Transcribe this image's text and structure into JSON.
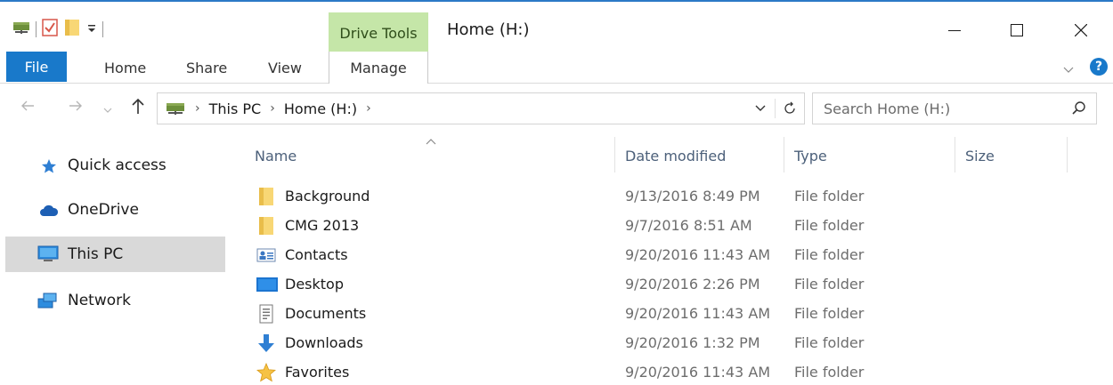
{
  "window": {
    "title": "Home (H:)",
    "context_tab": "Drive Tools"
  },
  "ribbon": {
    "tabs": [
      "File",
      "Home",
      "Share",
      "View",
      "Manage"
    ]
  },
  "address": {
    "crumbs": [
      "This PC",
      "Home (H:)"
    ]
  },
  "search": {
    "placeholder": "Search Home (H:)"
  },
  "sidebar": {
    "items": [
      {
        "label": "Quick access",
        "icon": "star-icon"
      },
      {
        "label": "OneDrive",
        "icon": "cloud-icon"
      },
      {
        "label": "This PC",
        "icon": "computer-icon",
        "selected": true
      },
      {
        "label": "Network",
        "icon": "network-icon"
      }
    ]
  },
  "columns": [
    "Name",
    "Date modified",
    "Type",
    "Size"
  ],
  "files": [
    {
      "name": "Background",
      "date": "9/13/2016 8:49 PM",
      "type": "File folder",
      "icon": "folder-icon"
    },
    {
      "name": "CMG 2013",
      "date": "9/7/2016 8:51 AM",
      "type": "File folder",
      "icon": "folder-icon"
    },
    {
      "name": "Contacts",
      "date": "9/20/2016 11:43 AM",
      "type": "File folder",
      "icon": "contacts-icon"
    },
    {
      "name": "Desktop",
      "date": "9/20/2016 2:26 PM",
      "type": "File folder",
      "icon": "desktop-icon"
    },
    {
      "name": "Documents",
      "date": "9/20/2016 11:43 AM",
      "type": "File folder",
      "icon": "documents-icon"
    },
    {
      "name": "Downloads",
      "date": "9/20/2016 1:32 PM",
      "type": "File folder",
      "icon": "downloads-icon"
    },
    {
      "name": "Favorites",
      "date": "9/20/2016 11:43 AM",
      "type": "File folder",
      "icon": "favorites-icon"
    }
  ],
  "colors": {
    "accent": "#1979ca",
    "context_tab": "#c5e6a8",
    "selected": "#d9d9d9",
    "folder": "#f8d775"
  }
}
